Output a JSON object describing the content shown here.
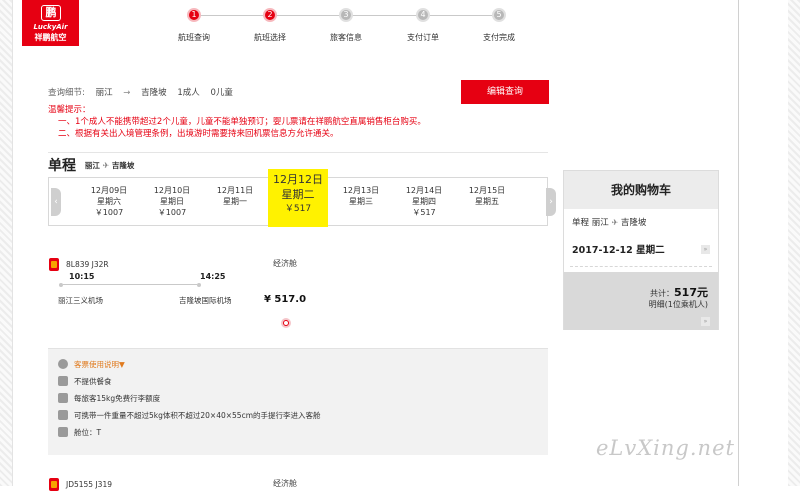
{
  "brand": {
    "logo_mark": "鹏",
    "logo_en": "LuckyAir",
    "logo_cn": "祥鹏航空",
    "color": "#e60012"
  },
  "steps": [
    {
      "num": "1",
      "label": "航班查询",
      "state": "active"
    },
    {
      "num": "2",
      "label": "航班选择",
      "state": "active"
    },
    {
      "num": "3",
      "label": "旅客信息",
      "state": "inactive"
    },
    {
      "num": "4",
      "label": "支付订单",
      "state": "inactive"
    },
    {
      "num": "5",
      "label": "支付完成",
      "state": "inactive"
    }
  ],
  "query": {
    "label": "查询细节:",
    "from": "丽江",
    "arrow": "→",
    "to": "吉隆坡",
    "adults": "1成人",
    "children": "0儿童",
    "edit_button": "编辑查询"
  },
  "tips": {
    "title": "温馨提示：",
    "line1": "一、1个成人不能携带超过2个儿童，儿童不能单独预订；婴儿票请在祥鹏航空直属销售柜台购买。",
    "line2": "二、根据有关出入境管理条例，出境游时需要持来回机票信息方允许通关。"
  },
  "trip": {
    "title": "单程",
    "from": "丽江",
    "plane": "✈",
    "to": "吉隆坡"
  },
  "dates": [
    {
      "date": "12月09日",
      "weekday": "星期六",
      "price": "￥1007"
    },
    {
      "date": "12月10日",
      "weekday": "星期日",
      "price": "￥1007"
    },
    {
      "date": "12月11日",
      "weekday": "星期一",
      "price": ""
    },
    {
      "date": "12月12日",
      "weekday": "星期二",
      "price": "￥517"
    },
    {
      "date": "12月13日",
      "weekday": "星期三",
      "price": ""
    },
    {
      "date": "12月14日",
      "weekday": "星期四",
      "price": "￥517"
    },
    {
      "date": "12月15日",
      "weekday": "星期五",
      "price": ""
    }
  ],
  "cart": {
    "title": "我的购物车",
    "trip_type": "单程",
    "from": "丽江",
    "plane": "✈",
    "to": "吉隆坡",
    "date": "2017-12-12 星期二",
    "total_label": "共计：",
    "total_value": "517元",
    "detail": "明细(1位乘机人)",
    "toggle": "»"
  },
  "flights": [
    {
      "code": "8L839 J32R",
      "dep_time": "10:15",
      "arr_time": "14:25",
      "dep_airport": "丽江三义机场",
      "arr_airport": "吉隆坡国际机场",
      "fare_class": "经济舱",
      "price": "¥ 517.0"
    },
    {
      "code": "JD5155 J319",
      "fare_class": "经济舱"
    }
  ],
  "fare_info": {
    "rules_link": "客票使用说明",
    "rules_caret": "▼",
    "meal": "不提供餐食",
    "baggage": "每旅客15kg免费行李额度",
    "carry_on": "可携带一件重量不超过5kg体积不超过20×40×55cm的手提行李进入客舱",
    "cabin": "舱位：T"
  },
  "watermark": "eLvXing.net"
}
